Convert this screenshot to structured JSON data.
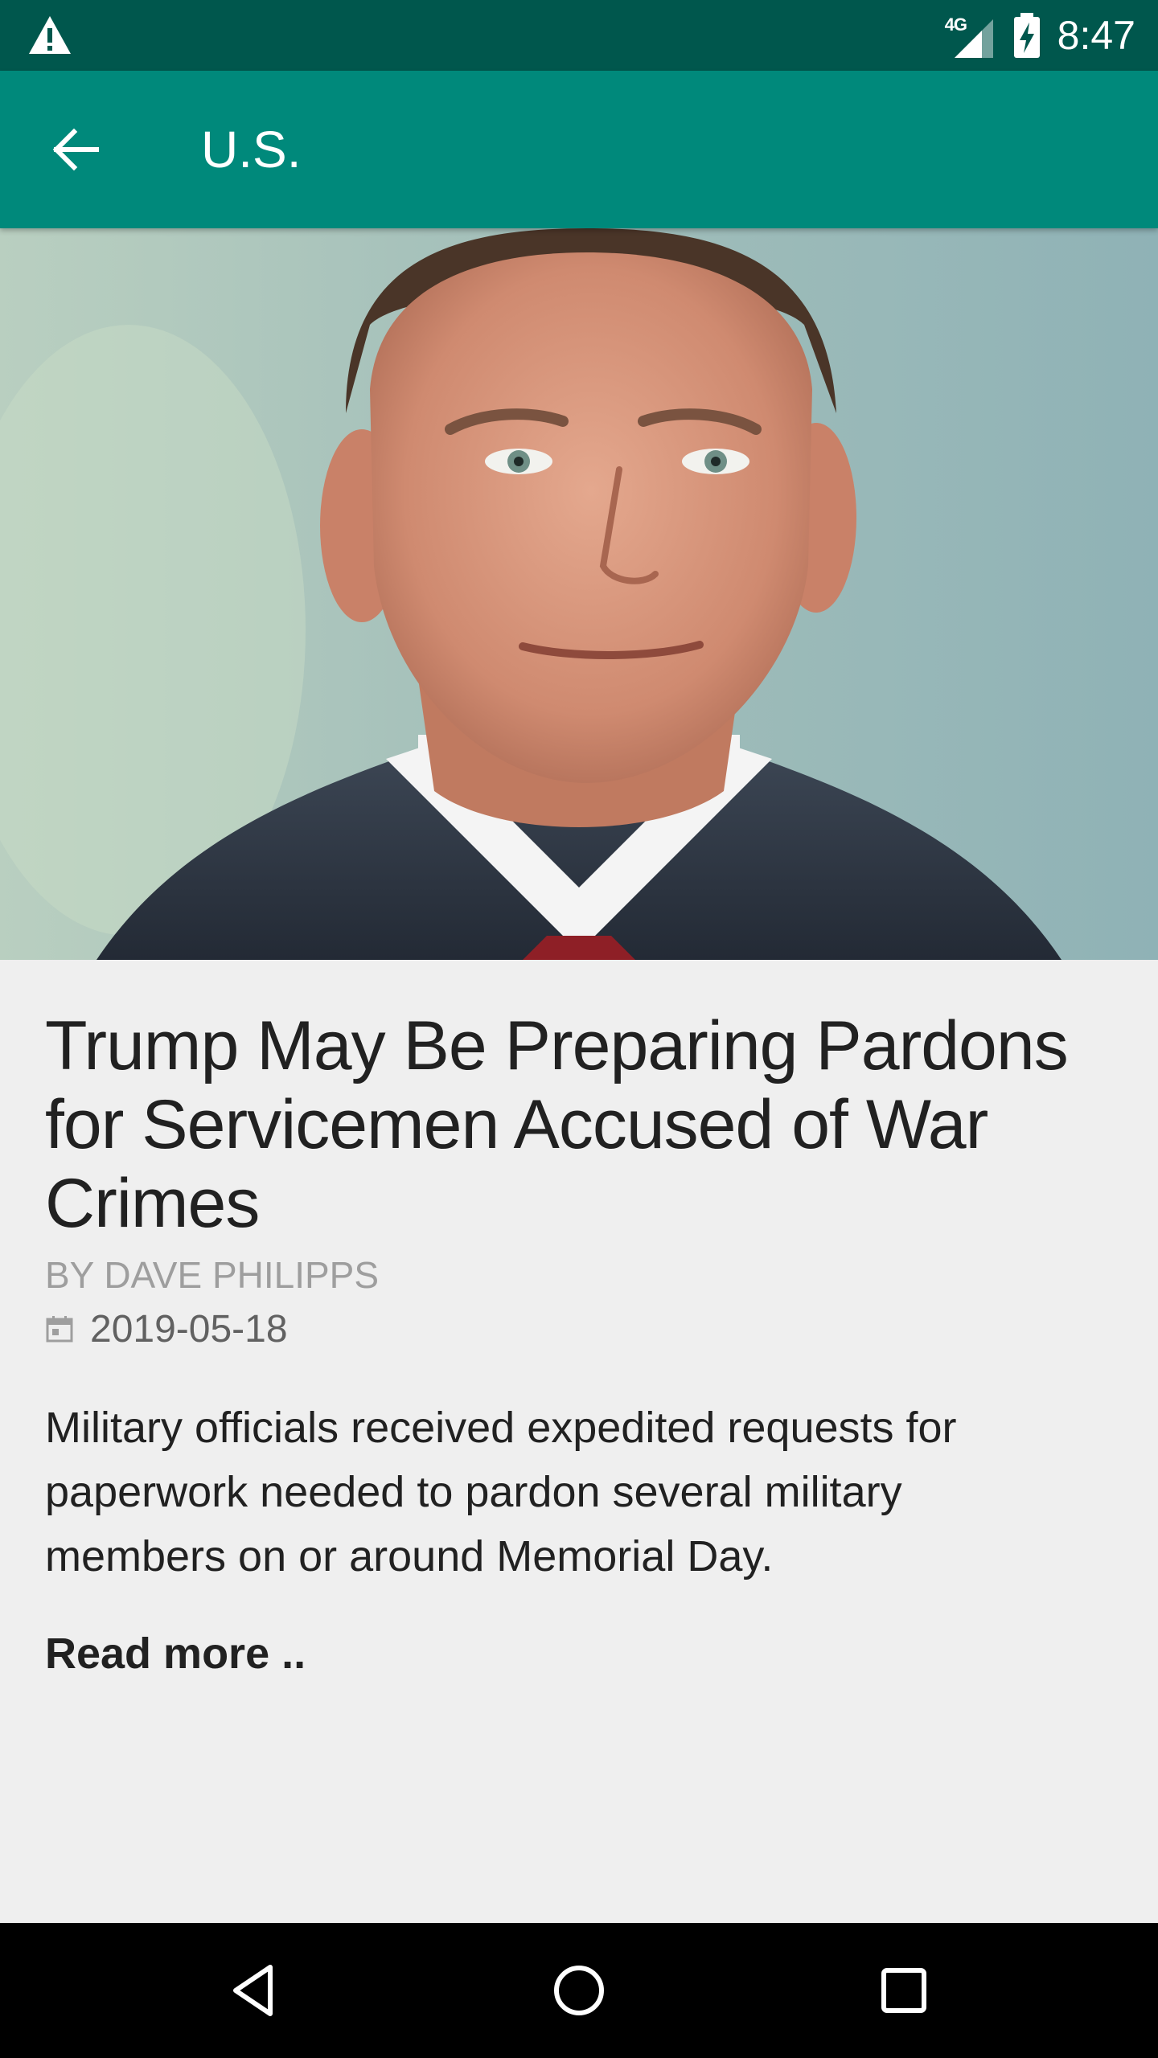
{
  "status_bar": {
    "network_type": "4G",
    "time": "8:47"
  },
  "app_bar": {
    "title": "U.S."
  },
  "article": {
    "headline": "Trump May Be Preparing Pardons for Servicemen Accused of War Crimes",
    "byline": "BY DAVE PHILIPPS",
    "date": "2019-05-18",
    "summary": "Military officials received expedited requests for paperwork needed to pardon several military members on or around Memorial Day.",
    "read_more_label": "Read more .."
  },
  "colors": {
    "status_bar": "#00574d",
    "app_bar": "#00897b",
    "background": "#efefef",
    "text_primary": "#212121",
    "text_secondary": "#9e9e9e",
    "nav_bar": "#000000"
  },
  "icons": {
    "status_warning": "warning-icon",
    "status_signal": "cell-signal-icon",
    "status_battery": "battery-charging-icon",
    "app_back": "arrow-back-icon",
    "date": "calendar-icon",
    "nav_back": "triangle-back-icon",
    "nav_home": "circle-home-icon",
    "nav_recents": "square-recents-icon"
  }
}
